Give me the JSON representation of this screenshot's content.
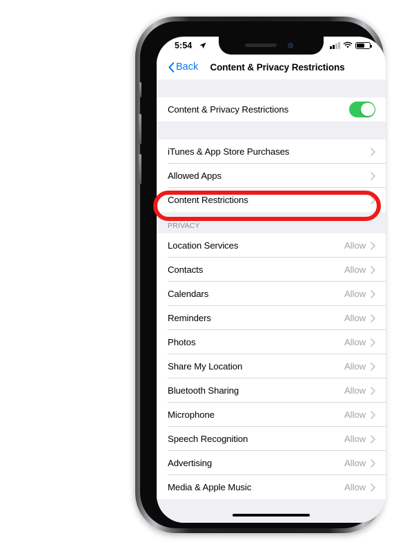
{
  "status_bar": {
    "time": "5:54",
    "location_arrow_icon": "location-arrow-icon",
    "cellular_icon": "signal-bars-icon",
    "wifi_icon": "wifi-icon",
    "battery_icon": "battery-icon"
  },
  "nav": {
    "back_label": "Back",
    "back_icon": "chevron-left-icon",
    "title": "Content & Privacy Restrictions"
  },
  "master_toggle": {
    "label": "Content & Privacy Restrictions",
    "state": "on",
    "color": "#34C759"
  },
  "restrictions_group": [
    {
      "label": "iTunes & App Store Purchases",
      "value": "",
      "chevron": true
    },
    {
      "label": "Allowed Apps",
      "value": "",
      "chevron": true
    },
    {
      "label": "Content Restrictions",
      "value": "",
      "chevron": true,
      "highlighted": true
    }
  ],
  "privacy_section": {
    "header": "PRIVACY",
    "rows": [
      {
        "label": "Location Services",
        "value": "Allow"
      },
      {
        "label": "Contacts",
        "value": "Allow"
      },
      {
        "label": "Calendars",
        "value": "Allow"
      },
      {
        "label": "Reminders",
        "value": "Allow"
      },
      {
        "label": "Photos",
        "value": "Allow"
      },
      {
        "label": "Share My Location",
        "value": "Allow"
      },
      {
        "label": "Bluetooth Sharing",
        "value": "Allow"
      },
      {
        "label": "Microphone",
        "value": "Allow"
      },
      {
        "label": "Speech Recognition",
        "value": "Allow"
      },
      {
        "label": "Advertising",
        "value": "Allow"
      },
      {
        "label": "Media & Apple Music",
        "value": "Allow"
      }
    ]
  },
  "annotation": {
    "shape": "oval",
    "color": "#EE1B19",
    "targets": "Content Restrictions"
  },
  "theme": {
    "accent_blue": "#007AFF",
    "background_gray": "#EFEFF4",
    "row_white": "#FFFFFF",
    "value_gray": "#A3A3A8"
  }
}
